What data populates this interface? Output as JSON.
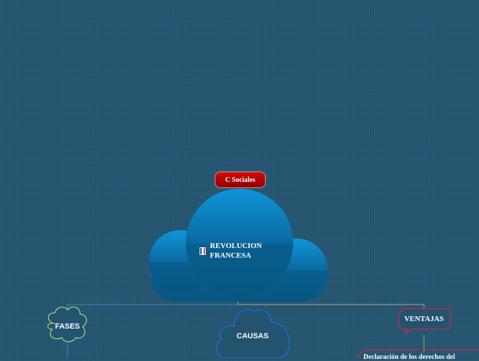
{
  "colors": {
    "background": "#23536f",
    "main_topic": "#0a6aa0",
    "badge": "#c00000",
    "fases_border": "#c8f07a",
    "causas_border": "#1e6fe8",
    "ventajas_border": "#cc2a3a"
  },
  "badge": {
    "label": "C Sociales"
  },
  "main_topic": {
    "line1": "REVOLUCION",
    "line2": "FRANCESA",
    "icon": "france-flag-icon"
  },
  "subtopics": {
    "fases": {
      "label": "FASES"
    },
    "causas": {
      "label": "CAUSAS"
    },
    "ventajas": {
      "label": "VENTAJAS"
    }
  },
  "cut_off_node": {
    "text": "Declaración de los derechos del"
  }
}
